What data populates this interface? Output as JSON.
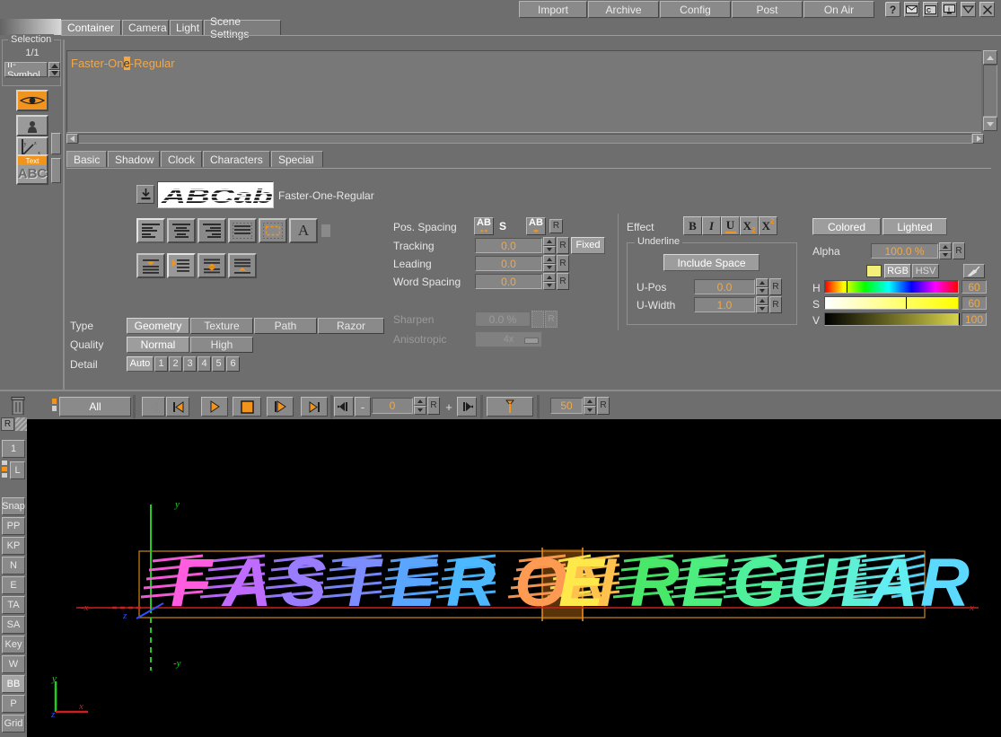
{
  "window": {
    "top_buttons": [
      "Import",
      "Archive",
      "Config",
      "Post",
      "On Air"
    ],
    "icon_buttons": [
      "help-icon",
      "mail-icon",
      "console-icon",
      "info-icon",
      "minimize-icon",
      "close-icon"
    ],
    "icon_glyphs": [
      "?",
      "✉",
      "C",
      "i",
      "▽",
      "✕"
    ]
  },
  "main_tabs": [
    {
      "label": "Container",
      "active": true
    },
    {
      "label": "Camera",
      "active": false
    },
    {
      "label": "Light",
      "active": false
    },
    {
      "label": "Scene Settings",
      "active": false
    }
  ],
  "selection": {
    "title": "Selection",
    "count": "1/1",
    "combo_value": "II-Symbol"
  },
  "editor": {
    "text_before": "Faster-On",
    "text_selected": "e",
    "text_after": "-Regular"
  },
  "sub_tabs": [
    {
      "label": "Basic",
      "active": true
    },
    {
      "label": "Shadow",
      "active": false
    },
    {
      "label": "Clock",
      "active": false
    },
    {
      "label": "Characters",
      "active": false
    },
    {
      "label": "Special",
      "active": false
    }
  ],
  "font": {
    "preview_text": "ABCab",
    "name": "Faster-One-Regular",
    "download_icon": "download-icon"
  },
  "spacing": {
    "pos_spacing_label": "Pos. Spacing",
    "pos_spacing_buttons": [
      "AB",
      "S",
      "AB"
    ],
    "pos_spacing_reset": "R",
    "rows": [
      {
        "label": "Tracking",
        "value": "0.0",
        "reset": "R",
        "extra": "Fixed"
      },
      {
        "label": "Leading",
        "value": "0.0",
        "reset": "R",
        "extra": ""
      },
      {
        "label": "Word Spacing",
        "value": "0.0",
        "reset": "R",
        "extra": ""
      }
    ],
    "sharpen_label": "Sharpen",
    "sharpen_value": "0.0 %",
    "sharpen_reset": "R",
    "aniso_label": "Anisotropic",
    "aniso_value": "4x"
  },
  "effect": {
    "label": "Effect",
    "buttons": [
      "B",
      "I",
      "U",
      "X",
      "X"
    ],
    "sub": [
      "",
      "",
      "",
      "2",
      "2"
    ],
    "underline": {
      "title": "Underline",
      "include_space": "Include Space",
      "rows": [
        {
          "label": "U-Pos",
          "value": "0.0",
          "reset": "R"
        },
        {
          "label": "U-Width",
          "value": "1.0",
          "reset": "R"
        }
      ]
    }
  },
  "material": {
    "colored": "Colored",
    "lighted": "Lighted",
    "alpha_label": "Alpha",
    "alpha_value": "100.0 %",
    "alpha_reset": "R",
    "mode_rgb": "RGB",
    "mode_hsv": "HSV",
    "swatch_color": "#f2ef7a",
    "picker_icon": "eyedropper-icon",
    "channels": [
      {
        "label": "H",
        "value": "60"
      },
      {
        "label": "S",
        "value": "60"
      },
      {
        "label": "V",
        "value": "100"
      }
    ]
  },
  "geometry": {
    "type_label": "Type",
    "type_options": [
      "Geometry",
      "Texture",
      "Path",
      "Razor"
    ],
    "type_selected": "Geometry",
    "quality_label": "Quality",
    "quality_options": [
      "Normal",
      "High"
    ],
    "quality_selected": "Normal",
    "detail_label": "Detail",
    "detail_options": [
      "Auto",
      "1",
      "2",
      "3",
      "4",
      "5",
      "6"
    ],
    "detail_selected": "Auto"
  },
  "transport": {
    "trash_icon": "trash-icon",
    "all_label": "All",
    "buttons": [
      "step-back-icon",
      "go-to-start-icon",
      "play-icon",
      "stop-icon",
      "play-to-end-icon",
      "go-to-end-icon"
    ],
    "key_prev_icon": "key-prev-icon",
    "minus": "-",
    "frame_value": "0",
    "frame_reset": "R",
    "plus": "+",
    "key_next_icon": "key-next-icon",
    "cursor_icon": "time-cursor-icon",
    "length_value": "50",
    "length_reset": "R"
  },
  "left_rail": {
    "reset_label": "R",
    "layer_label": "1",
    "layer_letter": "L",
    "buttons": [
      "Snap",
      "PP",
      "KP",
      "N",
      "E",
      "TA",
      "SA",
      "Key",
      "W",
      "BB",
      "P",
      "Grid"
    ],
    "active_button": "BB"
  },
  "viewport": {
    "text": "FASTER ONE REGULAR",
    "axis_labels": {
      "y_top": "y",
      "y_bottom": "-y",
      "x_left": "-x",
      "x_right": "x",
      "z": "z"
    },
    "gizmo_labels": {
      "x": "x",
      "y": "y",
      "z": "z"
    },
    "letters": [
      {
        "ch": "F",
        "color": "#ff5ce0"
      },
      {
        "ch": "A",
        "color": "#c06bff"
      },
      {
        "ch": "S",
        "color": "#9a7cff"
      },
      {
        "ch": "T",
        "color": "#7d8cff"
      },
      {
        "ch": "E",
        "color": "#5aa5ff"
      },
      {
        "ch": "R",
        "color": "#4cb8ff"
      },
      {
        "ch": "O",
        "color": "#ff9a52"
      },
      {
        "ch": "N",
        "color": "#ffc24d"
      },
      {
        "ch": "E",
        "color": "#ffe94a"
      },
      {
        "ch": "R",
        "color": "#49e86a"
      },
      {
        "ch": "E",
        "color": "#4ded80"
      },
      {
        "ch": "G",
        "color": "#4ff09c"
      },
      {
        "ch": "U",
        "color": "#57f0bd"
      },
      {
        "ch": "L",
        "color": "#5ef0d6"
      },
      {
        "ch": "A",
        "color": "#62eef0"
      },
      {
        "ch": "R",
        "color": "#5bd9ff"
      }
    ],
    "bbox_color": "#c07c16",
    "highlight_color": "#5a3408",
    "baseline_color": "#cc2020",
    "y_axis_color": "#20cc20",
    "z_axis_color": "#3050ff"
  }
}
